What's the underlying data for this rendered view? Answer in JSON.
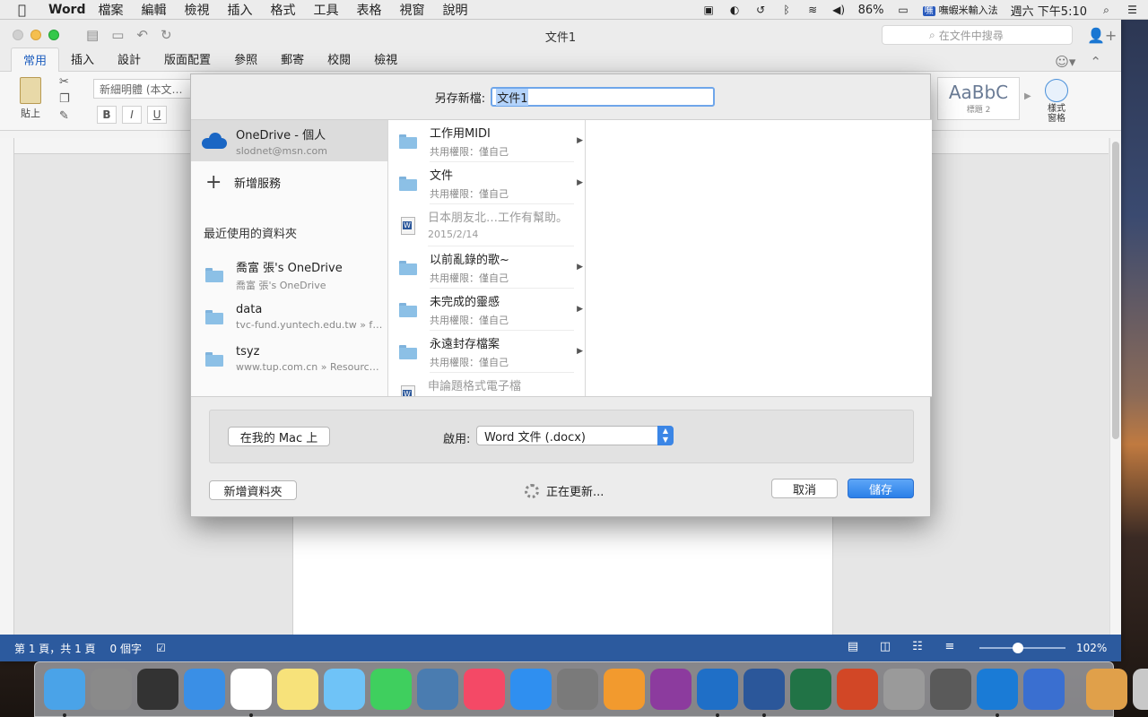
{
  "menubar": {
    "app_name": "Word",
    "items": [
      "檔案",
      "編輯",
      "檢視",
      "插入",
      "格式",
      "工具",
      "表格",
      "視窗",
      "說明"
    ],
    "battery": "86%",
    "ime": "嘸蝦米輸入法",
    "clock": "週六 下午5:10"
  },
  "window": {
    "title": "文件1",
    "search_placeholder": "在文件中搜尋",
    "tabs": [
      "常用",
      "插入",
      "設計",
      "版面配置",
      "參照",
      "郵寄",
      "校閱",
      "檢視"
    ],
    "active_tab": "常用"
  },
  "ribbon": {
    "paste_label": "貼上",
    "font_name": "新細明體 (本文…",
    "style_preview_text": "AaBbC",
    "style_preview_name": "標題 2",
    "style_pane_label": "樣式\n窗格"
  },
  "status": {
    "page_info": "第 1 頁，共 1 頁",
    "word_count": "0 個字",
    "zoom": "102%",
    "zoom_fraction": 0.45
  },
  "dialog": {
    "save_as_label": "另存新檔:",
    "filename": "文件1",
    "account": {
      "name": "OneDrive - 個人",
      "email": "slodnet@msn.com"
    },
    "add_service": "新增服務",
    "recent_header": "最近使用的資料夾",
    "recent": [
      {
        "name": "喬富 張's OneDrive",
        "path": "喬富 張's OneDrive"
      },
      {
        "name": "data",
        "path": "tvc-fund.yuntech.edu.tw » faq …"
      },
      {
        "name": "tsyz",
        "path": "www.tup.com.cn » Resource » …"
      }
    ],
    "files": [
      {
        "name": "工作用MIDI",
        "sub": "共用權限：僅自己",
        "type": "folder"
      },
      {
        "name": "文件",
        "sub": "共用權限：僅自己",
        "type": "folder"
      },
      {
        "name": "日本朋友北…工作有幫助。",
        "sub": "2015/2/14",
        "type": "doc"
      },
      {
        "name": "以前亂錄的歌~",
        "sub": "共用權限：僅自己",
        "type": "folder"
      },
      {
        "name": "未完成的靈感",
        "sub": "共用權限：僅自己",
        "type": "folder"
      },
      {
        "name": "永遠封存檔案",
        "sub": "共用權限：僅自己",
        "type": "folder"
      },
      {
        "name": "申論題格式電子檔",
        "sub": "",
        "type": "doc"
      }
    ],
    "on_my_mac_button": "在我的 Mac 上",
    "format_label": "啟用:",
    "format_value": "Word 文件 (.docx)",
    "new_folder_button": "新增資料夾",
    "updating_text": "正在更新...",
    "cancel_button": "取消",
    "save_button": "儲存"
  },
  "dock": {
    "apps": [
      {
        "name": "finder",
        "color": "#4aa3e8"
      },
      {
        "name": "launchpad",
        "color": "#8a8a8a"
      },
      {
        "name": "photo-booth",
        "color": "#333333"
      },
      {
        "name": "safari",
        "color": "#3a8fe6"
      },
      {
        "name": "calendar",
        "color": "#ffffff"
      },
      {
        "name": "notes",
        "color": "#f7e27a"
      },
      {
        "name": "messages",
        "color": "#6fc3f7"
      },
      {
        "name": "facetime",
        "color": "#3fcf5e"
      },
      {
        "name": "iphoto",
        "color": "#4a7cb0"
      },
      {
        "name": "itunes",
        "color": "#f44966"
      },
      {
        "name": "app-store",
        "color": "#2f8ff0"
      },
      {
        "name": "system-preferences",
        "color": "#7a7a7a"
      },
      {
        "name": "game",
        "color": "#f29a2e"
      },
      {
        "name": "onenote",
        "color": "#8c3b9e"
      },
      {
        "name": "outlook",
        "color": "#1f6fc7"
      },
      {
        "name": "word",
        "color": "#2b579a"
      },
      {
        "name": "excel",
        "color": "#217346"
      },
      {
        "name": "powerpoint",
        "color": "#d24726"
      },
      {
        "name": "printer",
        "color": "#9a9a9a"
      },
      {
        "name": "disk-utility",
        "color": "#5a5a5a"
      },
      {
        "name": "teamviewer",
        "color": "#1a7bd6"
      },
      {
        "name": "word-web",
        "color": "#3a6fd0"
      },
      {
        "name": "downloads",
        "color": "#e0a04a"
      },
      {
        "name": "trash",
        "color": "#c8c8c8"
      }
    ]
  }
}
